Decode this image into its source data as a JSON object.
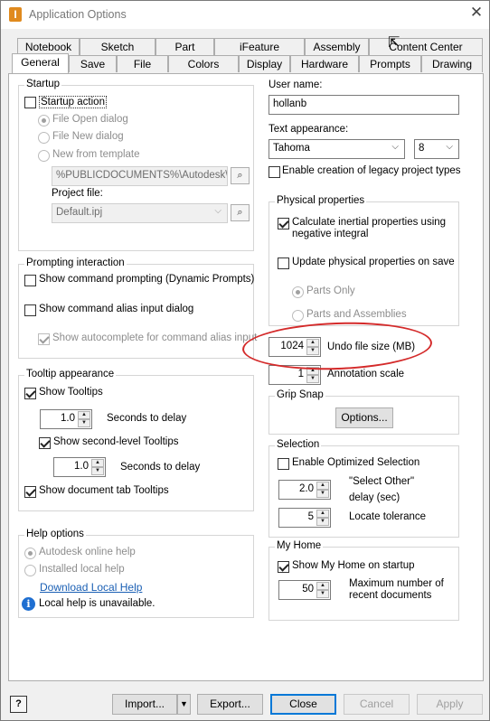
{
  "window": {
    "title": "Application Options",
    "icon_letter": "I"
  },
  "tabs_row1": [
    "Notebook",
    "Sketch",
    "Part",
    "iFeature",
    "Assembly",
    "Content Center"
  ],
  "tabs_row2": [
    "General",
    "Save",
    "File",
    "Colors",
    "Display",
    "Hardware",
    "Prompts",
    "Drawing"
  ],
  "active_tab": "General",
  "startup": {
    "title": "Startup",
    "startup_action": {
      "label": "Startup action",
      "checked": false
    },
    "options": [
      "File Open dialog",
      "File New dialog",
      "New from template"
    ],
    "selected_option": "File Open dialog",
    "template_path": "%PUBLICDOCUMENTS%\\Autodesk\\Inv",
    "project_file_label": "Project file:",
    "project_file": "Default.ipj"
  },
  "prompting": {
    "title": "Prompting interaction",
    "show_command_prompting": {
      "label": "Show command prompting (Dynamic Prompts)",
      "checked": false
    },
    "show_alias_dialog": {
      "label": "Show command alias input dialog",
      "checked": false
    },
    "show_autocomplete": {
      "label": "Show autocomplete for command alias input",
      "checked": true
    }
  },
  "tooltip": {
    "title": "Tooltip appearance",
    "show_tooltips": {
      "label": "Show Tooltips",
      "checked": true
    },
    "seconds_delay_1": "1.0",
    "seconds_label": "Seconds to delay",
    "show_second_level": {
      "label": "Show second-level Tooltips",
      "checked": true
    },
    "seconds_delay_2": "1.0",
    "show_doc_tab": {
      "label": "Show document tab Tooltips",
      "checked": true
    }
  },
  "help": {
    "title": "Help options",
    "options": [
      "Autodesk online help",
      "Installed local help"
    ],
    "selected_option": "Autodesk online help",
    "download_link": "Download Local Help",
    "status": "Local help is unavailable."
  },
  "user": {
    "label": "User name:",
    "value": "hollanb"
  },
  "text_appearance": {
    "label": "Text appearance:",
    "font": "Tahoma",
    "size": "8",
    "legacy_project": {
      "label": "Enable creation of legacy project types",
      "checked": false
    }
  },
  "physical": {
    "title": "Physical properties",
    "inertial": {
      "label_line1": "Calculate inertial properties using",
      "label_line2": "negative integral",
      "checked": true
    },
    "update_on_save": {
      "label": "Update physical properties on save",
      "checked": false
    },
    "options": [
      "Parts Only",
      "Parts and Assemblies"
    ],
    "selected_option": "Parts Only"
  },
  "undo": {
    "value": "1024",
    "label": "Undo file size (MB)"
  },
  "annotation": {
    "value": "1",
    "label": "Annotation scale"
  },
  "grip_snap": {
    "title": "Grip Snap",
    "options_button": "Options..."
  },
  "selection": {
    "title": "Selection",
    "optimized": {
      "label": "Enable Optimized Selection",
      "checked": false
    },
    "select_other_value": "2.0",
    "select_other_label1": "\"Select Other\"",
    "select_other_label2": "delay (sec)",
    "locate_value": "5",
    "locate_label": "Locate tolerance"
  },
  "my_home": {
    "title": "My Home",
    "show_on_startup": {
      "label": "Show My Home on startup",
      "checked": true
    },
    "max_recent_value": "50",
    "max_recent_label1": "Maximum number of",
    "max_recent_label2": "recent documents"
  },
  "footer": {
    "help_label": "?",
    "import": "Import...",
    "export": "Export...",
    "close": "Close",
    "cancel": "Cancel",
    "apply": "Apply"
  },
  "colors": {
    "annotation_ellipse": "#d42a2a",
    "link": "#1a5fb4",
    "info": "#1f6fd1"
  }
}
